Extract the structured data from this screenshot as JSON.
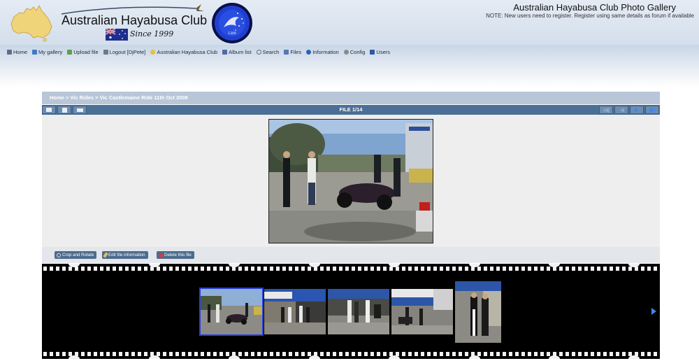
{
  "header": {
    "site_name": "Australian Hayabusa Club",
    "since": "Since 1999",
    "gallery_title": "Australian Hayabusa Club Photo Gallery",
    "note": "NOTE: New users need to register. Register using same details as forum if available",
    "emblem_top_text": "AUSTRALIAN HAYABUSA CLUB",
    "emblem_bottom_text": "1300"
  },
  "nav": {
    "items": [
      {
        "label": "Home",
        "icon": "home-icon",
        "color": "#5a6f8a"
      },
      {
        "label": "My gallery",
        "icon": "my-gallery-icon",
        "color": "#3f7ac4"
      },
      {
        "label": "Upload file",
        "icon": "upload-icon",
        "color": "#5da04a"
      },
      {
        "label": "Logout [DjPete]",
        "icon": "logout-icon",
        "color": "#6b7a8c"
      },
      {
        "label": "Australian Hayabusa Club",
        "icon": "bulb-icon",
        "color": "#e2c23a"
      },
      {
        "label": "Album list",
        "icon": "album-list-icon",
        "color": "#4f6ea0"
      },
      {
        "label": "Search",
        "icon": "search-icon",
        "color": "#5d6e82"
      },
      {
        "label": "Files",
        "icon": "files-icon",
        "color": "#5579b0"
      },
      {
        "label": "Information",
        "icon": "info-icon",
        "color": "#2c63b8"
      },
      {
        "label": "Config",
        "icon": "config-icon",
        "color": "#8a8a8a"
      },
      {
        "label": "Users",
        "icon": "users-icon",
        "color": "#2d58a8"
      }
    ]
  },
  "breadcrumb": {
    "home": "Home",
    "sep1": " > ",
    "album": "Vic Rides",
    "sep2": " > ",
    "current": "Vic Castlemaine Ride 11th Oct 2008"
  },
  "toolbar": {
    "file_counter": "FILE 1/14"
  },
  "actions": {
    "crop": "Crop and Rotate",
    "edit": "Edit file information",
    "delete": "Delete this file"
  },
  "colors": {
    "toolbar_blue": "#4b6f95",
    "breadcrumb_blue": "#b8c6d8",
    "accent_arrow": "#3e87e8",
    "active_thumb_border": "#2a3fd8"
  }
}
